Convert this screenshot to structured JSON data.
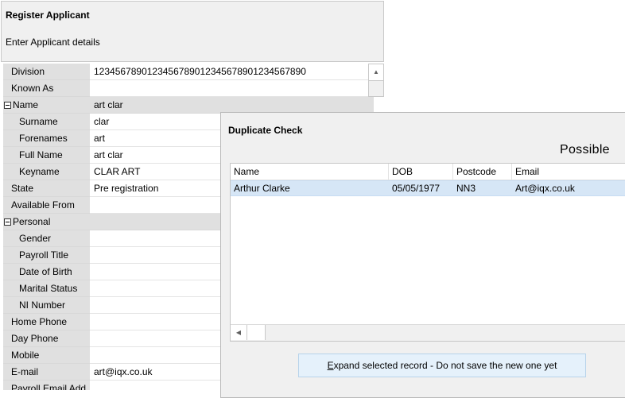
{
  "register": {
    "title": "Register Applicant",
    "subtitle": "Enter Applicant details"
  },
  "fields": [
    {
      "label": "Division",
      "value": "1234567890123456789012345678901234567890"
    },
    {
      "label": "Known As",
      "value": ""
    },
    {
      "label": "Name",
      "value": "art clar"
    },
    {
      "label": "Surname",
      "value": "clar"
    },
    {
      "label": "Forenames",
      "value": "art"
    },
    {
      "label": "Full Name",
      "value": "art clar"
    },
    {
      "label": "Keyname",
      "value": "CLAR ART"
    },
    {
      "label": "State",
      "value": "Pre registration"
    },
    {
      "label": "Available From",
      "value": ""
    },
    {
      "label": "Personal",
      "value": ""
    },
    {
      "label": "Gender",
      "value": ""
    },
    {
      "label": "Payroll Title",
      "value": ""
    },
    {
      "label": "Date of Birth",
      "value": ""
    },
    {
      "label": "Marital Status",
      "value": ""
    },
    {
      "label": "NI Number",
      "value": ""
    },
    {
      "label": "Home Phone",
      "value": ""
    },
    {
      "label": "Day Phone",
      "value": ""
    },
    {
      "label": "Mobile",
      "value": ""
    },
    {
      "label": "E-mail",
      "value": "art@iqx.co.uk"
    },
    {
      "label": "Payroll Email Add",
      "value": ""
    }
  ],
  "dialog": {
    "title": "Duplicate Check",
    "heading": "Possible",
    "columns": [
      "Name",
      "DOB",
      "Postcode",
      "Email"
    ],
    "rows": [
      {
        "name": "Arthur Clarke",
        "dob": "05/05/1977",
        "postcode": "NN3",
        "email": "Art@iqx.co.uk"
      }
    ],
    "expand_button": {
      "mnemonic": "E",
      "rest": "xpand selected record - Do not save the new one yet"
    }
  },
  "icons": {
    "scroll_up": "scroll-up-arrow-icon",
    "scroll_left": "scroll-left-arrow-icon",
    "collapse": "collapse-box-icon"
  }
}
